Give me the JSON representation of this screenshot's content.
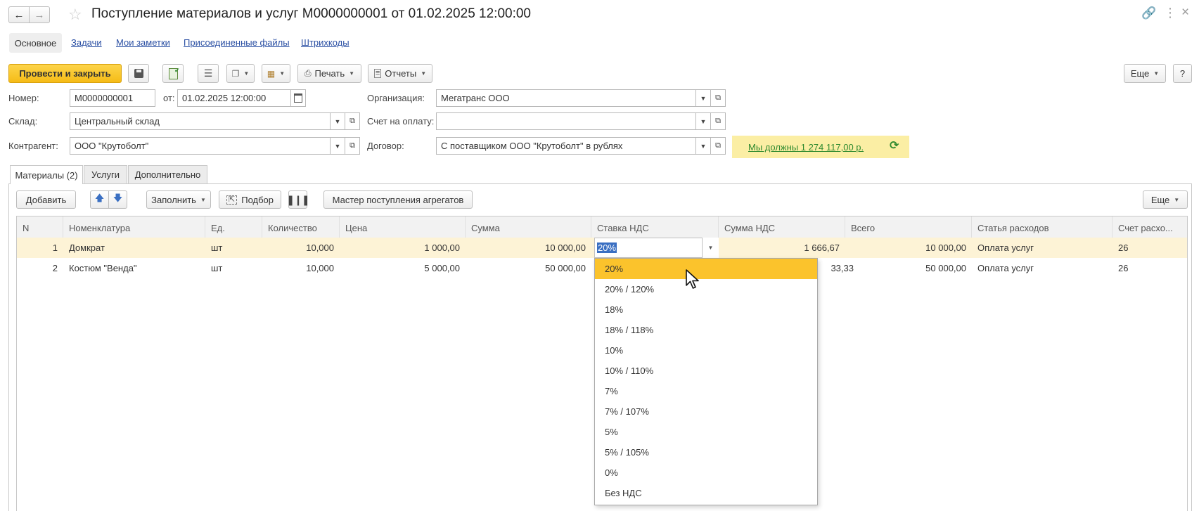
{
  "window": {
    "title": "Поступление материалов и услуг М0000000001 от 01.02.2025 12:00:00",
    "icons": [
      "arrow-left-icon",
      "arrow-right-icon",
      "star-icon",
      "link-icon",
      "more-vertical-icon",
      "close-icon"
    ]
  },
  "nav_tabs": [
    "Основное",
    "Задачи",
    "Мои заметки",
    "Присоединенные файлы",
    "Штрихкоды"
  ],
  "toolbar": {
    "post_and_close": "Провести и закрыть",
    "print": "Печать",
    "reports": "Отчеты",
    "more": "Еще",
    "help": "?"
  },
  "form": {
    "number_label": "Номер:",
    "number_value": "М0000000001",
    "date_label": "от:",
    "date_value": "01.02.2025 12:00:00",
    "org_label": "Организация:",
    "org_value": "Мегатранс ООО",
    "warehouse_label": "Склад:",
    "warehouse_value": "Центральный склад",
    "invoice_label": "Счет на оплату:",
    "invoice_value": "",
    "counterparty_label": "Контрагент:",
    "counterparty_value": "ООО \"Крутоболт\"",
    "contract_label": "Договор:",
    "contract_value": "С поставщиком ООО \"Крутоболт\" в рублях",
    "debt_link": "Мы должны 1 274 117,00 р."
  },
  "content_tabs": [
    "Материалы (2)",
    "Услуги",
    "Дополнительно"
  ],
  "table_toolbar": {
    "add": "Добавить",
    "fill": "Заполнить",
    "pick": "Подбор",
    "wizard": "Мастер поступления агрегатов",
    "more": "Еще"
  },
  "table": {
    "columns": [
      "N",
      "Номенклатура",
      "Ед.",
      "Количество",
      "Цена",
      "Сумма",
      "Ставка НДС",
      "Сумма НДС",
      "Всего",
      "Статья расходов",
      "Счет расхо..."
    ],
    "rows": [
      [
        "1",
        "Домкрат",
        "шт",
        "10,000",
        "1 000,00",
        "10 000,00",
        "20%",
        "1 666,67",
        "10 000,00",
        "Оплата услуг",
        "26"
      ],
      [
        "2",
        "Костюм \"Венда\"",
        "шт",
        "10,000",
        "5 000,00",
        "50 000,00",
        "",
        "8 333,33",
        "50 000,00",
        "Оплата услуг",
        "26"
      ]
    ],
    "row2_vat_visible": "33,33"
  },
  "vat_dropdown": {
    "options": [
      "20%",
      "20% / 120%",
      "18%",
      "18% / 118%",
      "10%",
      "10% / 110%",
      "7%",
      "7% / 107%",
      "5%",
      "5% / 105%",
      "0%",
      "Без НДС"
    ],
    "selected": "20%"
  },
  "colors": {
    "accent_yellow": "#fbc32c",
    "selected_row": "#fdf3d6",
    "debt_bg": "#fbeea4",
    "link_blue": "#2a4fa3",
    "debt_green": "#2f8a2f"
  }
}
